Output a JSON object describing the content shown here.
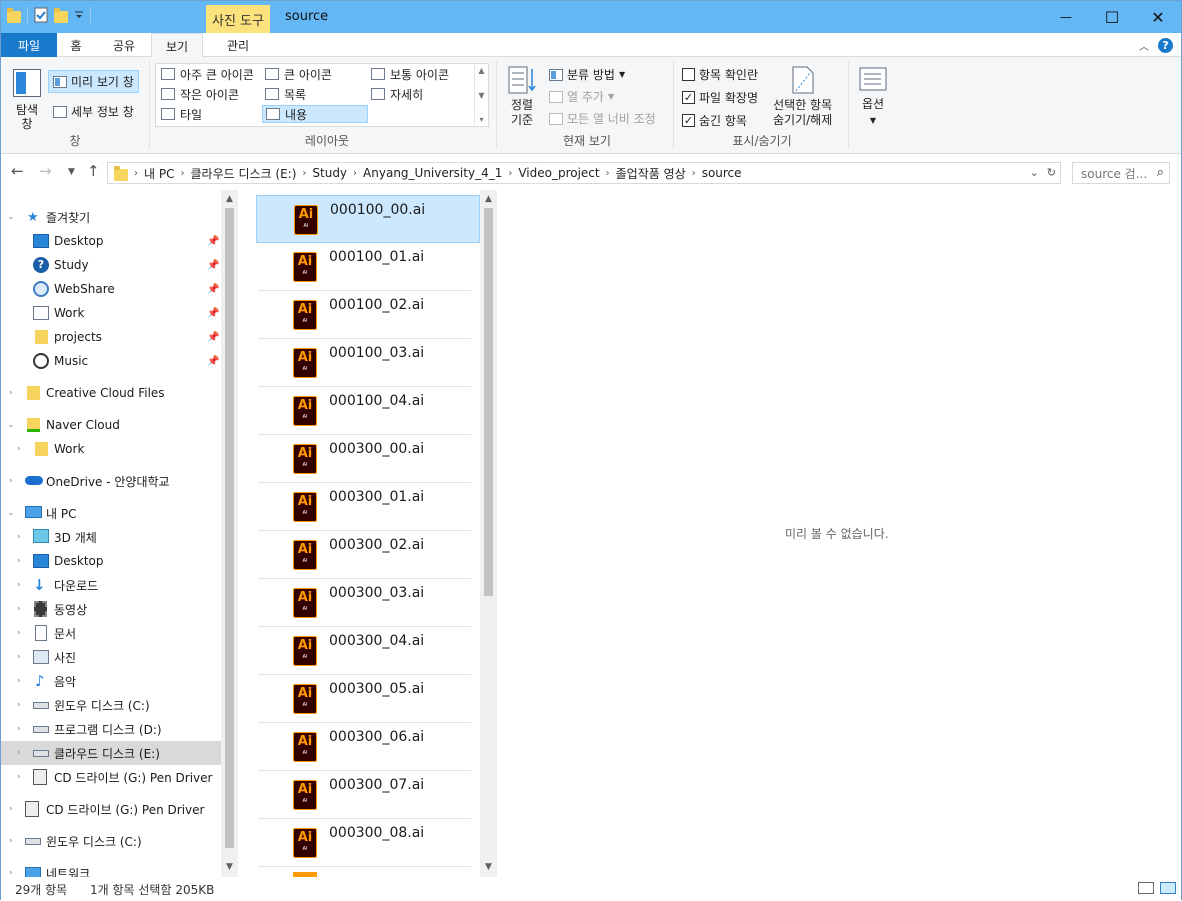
{
  "titlebar": {
    "context_tab": "사진 도구",
    "title": "source",
    "minimize": "—",
    "maximize": "☐",
    "close": "✕"
  },
  "ribbon_tabs": {
    "file": "파일",
    "home": "홈",
    "share": "공유",
    "view": "보기",
    "manage": "관리",
    "help": "?"
  },
  "ribbon": {
    "pane": {
      "nav_pane_label": "탐색\n창",
      "preview_pane": "미리 보기 창",
      "details_pane": "세부 정보 창",
      "group": "창"
    },
    "layout": {
      "items": [
        "아주 큰 아이콘",
        "큰 아이콘",
        "보통 아이콘",
        "작은 아이콘",
        "목록",
        "자세히",
        "타일",
        "내용"
      ],
      "selected": "내용",
      "group": "레이아웃"
    },
    "current_view": {
      "sort": "정렬\n기준",
      "group_by": "분류 방법",
      "add_columns": "열 추가",
      "size_all_columns": "모든 열 너비 조정",
      "group": "현재 보기"
    },
    "show_hide": {
      "item_checkboxes": "항목 확인란",
      "file_extensions": "파일 확장명",
      "hidden_items": "숨긴 항목",
      "hide_selected": "선택한 항목\n숨기기/해제",
      "group": "표시/숨기기"
    },
    "options": {
      "label": "옵션"
    }
  },
  "address": {
    "crumbs": [
      "내 PC",
      "클라우드 디스크 (E:)",
      "Study",
      "Anyang_University_4_1",
      "Video_project",
      "졸업작품 영상",
      "source"
    ],
    "search_placeholder": "source 검..."
  },
  "nav_tree": {
    "favorites": "즐겨찾기",
    "quick": [
      "Desktop",
      "Study",
      "WebShare",
      "Work",
      "projects",
      "Music"
    ],
    "creative_cloud": "Creative Cloud Files",
    "naver_cloud": "Naver Cloud",
    "naver_work": "Work",
    "onedrive": "OneDrive - 안양대학교",
    "this_pc": "내 PC",
    "pc_items": [
      "3D 개체",
      "Desktop",
      "다운로드",
      "동영상",
      "문서",
      "사진",
      "음악",
      "윈도우 디스크 (C:)",
      "프로그램 디스크 (D:)",
      "클라우드 디스크 (E:)",
      "CD 드라이브 (G:) Pen Driver"
    ],
    "cd_drive": "CD 드라이브 (G:) Pen Driver",
    "windows_disk": "윈도우 디스크 (C:)",
    "network": "네트워크"
  },
  "files": {
    "icon_label": "Ai",
    "icon_sub": "AI",
    "items": [
      "000100_00.ai",
      "000100_01.ai",
      "000100_02.ai",
      "000100_03.ai",
      "000100_04.ai",
      "000300_00.ai",
      "000300_01.ai",
      "000300_02.ai",
      "000300_03.ai",
      "000300_04.ai",
      "000300_05.ai",
      "000300_06.ai",
      "000300_07.ai",
      "000300_08.ai"
    ],
    "selected": "000100_00.ai"
  },
  "preview": {
    "message": "미리 볼 수 없습니다."
  },
  "status": {
    "item_count": "29개 항목",
    "selection": "1개 항목 선택함 205KB"
  }
}
